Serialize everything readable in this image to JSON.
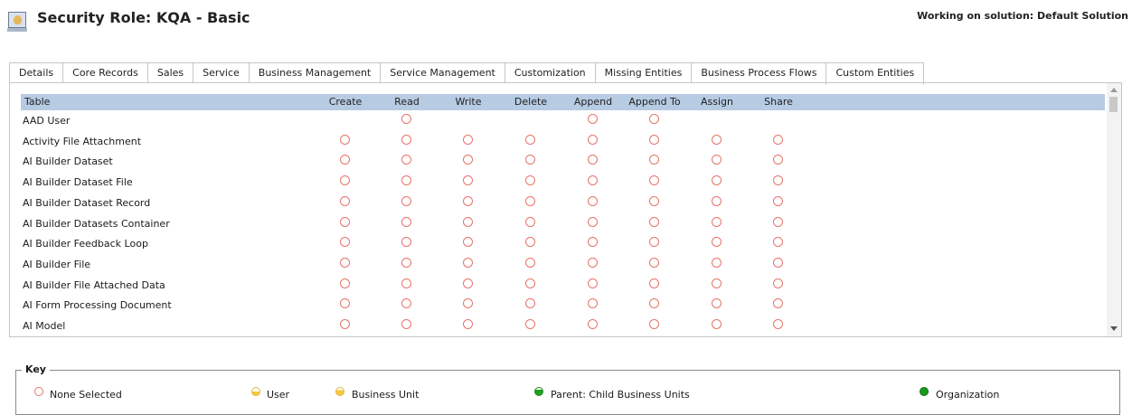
{
  "header": {
    "title": "Security Role: KQA - Basic",
    "solution": "Working on solution: Default Solution"
  },
  "tabs": [
    {
      "label": "Details"
    },
    {
      "label": "Core Records"
    },
    {
      "label": "Sales"
    },
    {
      "label": "Service"
    },
    {
      "label": "Business Management"
    },
    {
      "label": "Service Management"
    },
    {
      "label": "Customization"
    },
    {
      "label": "Missing Entities"
    },
    {
      "label": "Business Process Flows"
    },
    {
      "label": "Custom Entities",
      "active": true
    }
  ],
  "grid": {
    "columns": [
      "Table",
      "Create",
      "Read",
      "Write",
      "Delete",
      "Append",
      "Append To",
      "Assign",
      "Share"
    ],
    "rows": [
      {
        "name": "AAD User",
        "privileges": [
          false,
          true,
          false,
          false,
          true,
          true,
          false,
          false
        ]
      },
      {
        "name": "Activity File Attachment",
        "privileges": [
          true,
          true,
          true,
          true,
          true,
          true,
          true,
          true
        ]
      },
      {
        "name": "AI Builder Dataset",
        "privileges": [
          true,
          true,
          true,
          true,
          true,
          true,
          true,
          true
        ]
      },
      {
        "name": "AI Builder Dataset File",
        "privileges": [
          true,
          true,
          true,
          true,
          true,
          true,
          true,
          true
        ]
      },
      {
        "name": "AI Builder Dataset Record",
        "privileges": [
          true,
          true,
          true,
          true,
          true,
          true,
          true,
          true
        ]
      },
      {
        "name": "AI Builder Datasets Container",
        "privileges": [
          true,
          true,
          true,
          true,
          true,
          true,
          true,
          true
        ]
      },
      {
        "name": "AI Builder Feedback Loop",
        "privileges": [
          true,
          true,
          true,
          true,
          true,
          true,
          true,
          true
        ]
      },
      {
        "name": "AI Builder File",
        "privileges": [
          true,
          true,
          true,
          true,
          true,
          true,
          true,
          true
        ]
      },
      {
        "name": "AI Builder File Attached Data",
        "privileges": [
          true,
          true,
          true,
          true,
          true,
          true,
          true,
          true
        ]
      },
      {
        "name": "AI Form Processing Document",
        "privileges": [
          true,
          true,
          true,
          true,
          true,
          true,
          true,
          true
        ]
      },
      {
        "name": "AI Model",
        "privileges": [
          true,
          true,
          true,
          true,
          true,
          true,
          true,
          true
        ]
      }
    ],
    "privilege_level": "None Selected"
  },
  "key": {
    "title": "Key",
    "items": [
      {
        "label": "None Selected",
        "icon": "none-selected-icon"
      },
      {
        "label": "User",
        "icon": "user-level-icon"
      },
      {
        "label": "Business Unit",
        "icon": "business-unit-level-icon"
      },
      {
        "label": "Parent: Child Business Units",
        "icon": "parent-child-level-icon"
      },
      {
        "label": "Organization",
        "icon": "organization-level-icon"
      }
    ]
  }
}
